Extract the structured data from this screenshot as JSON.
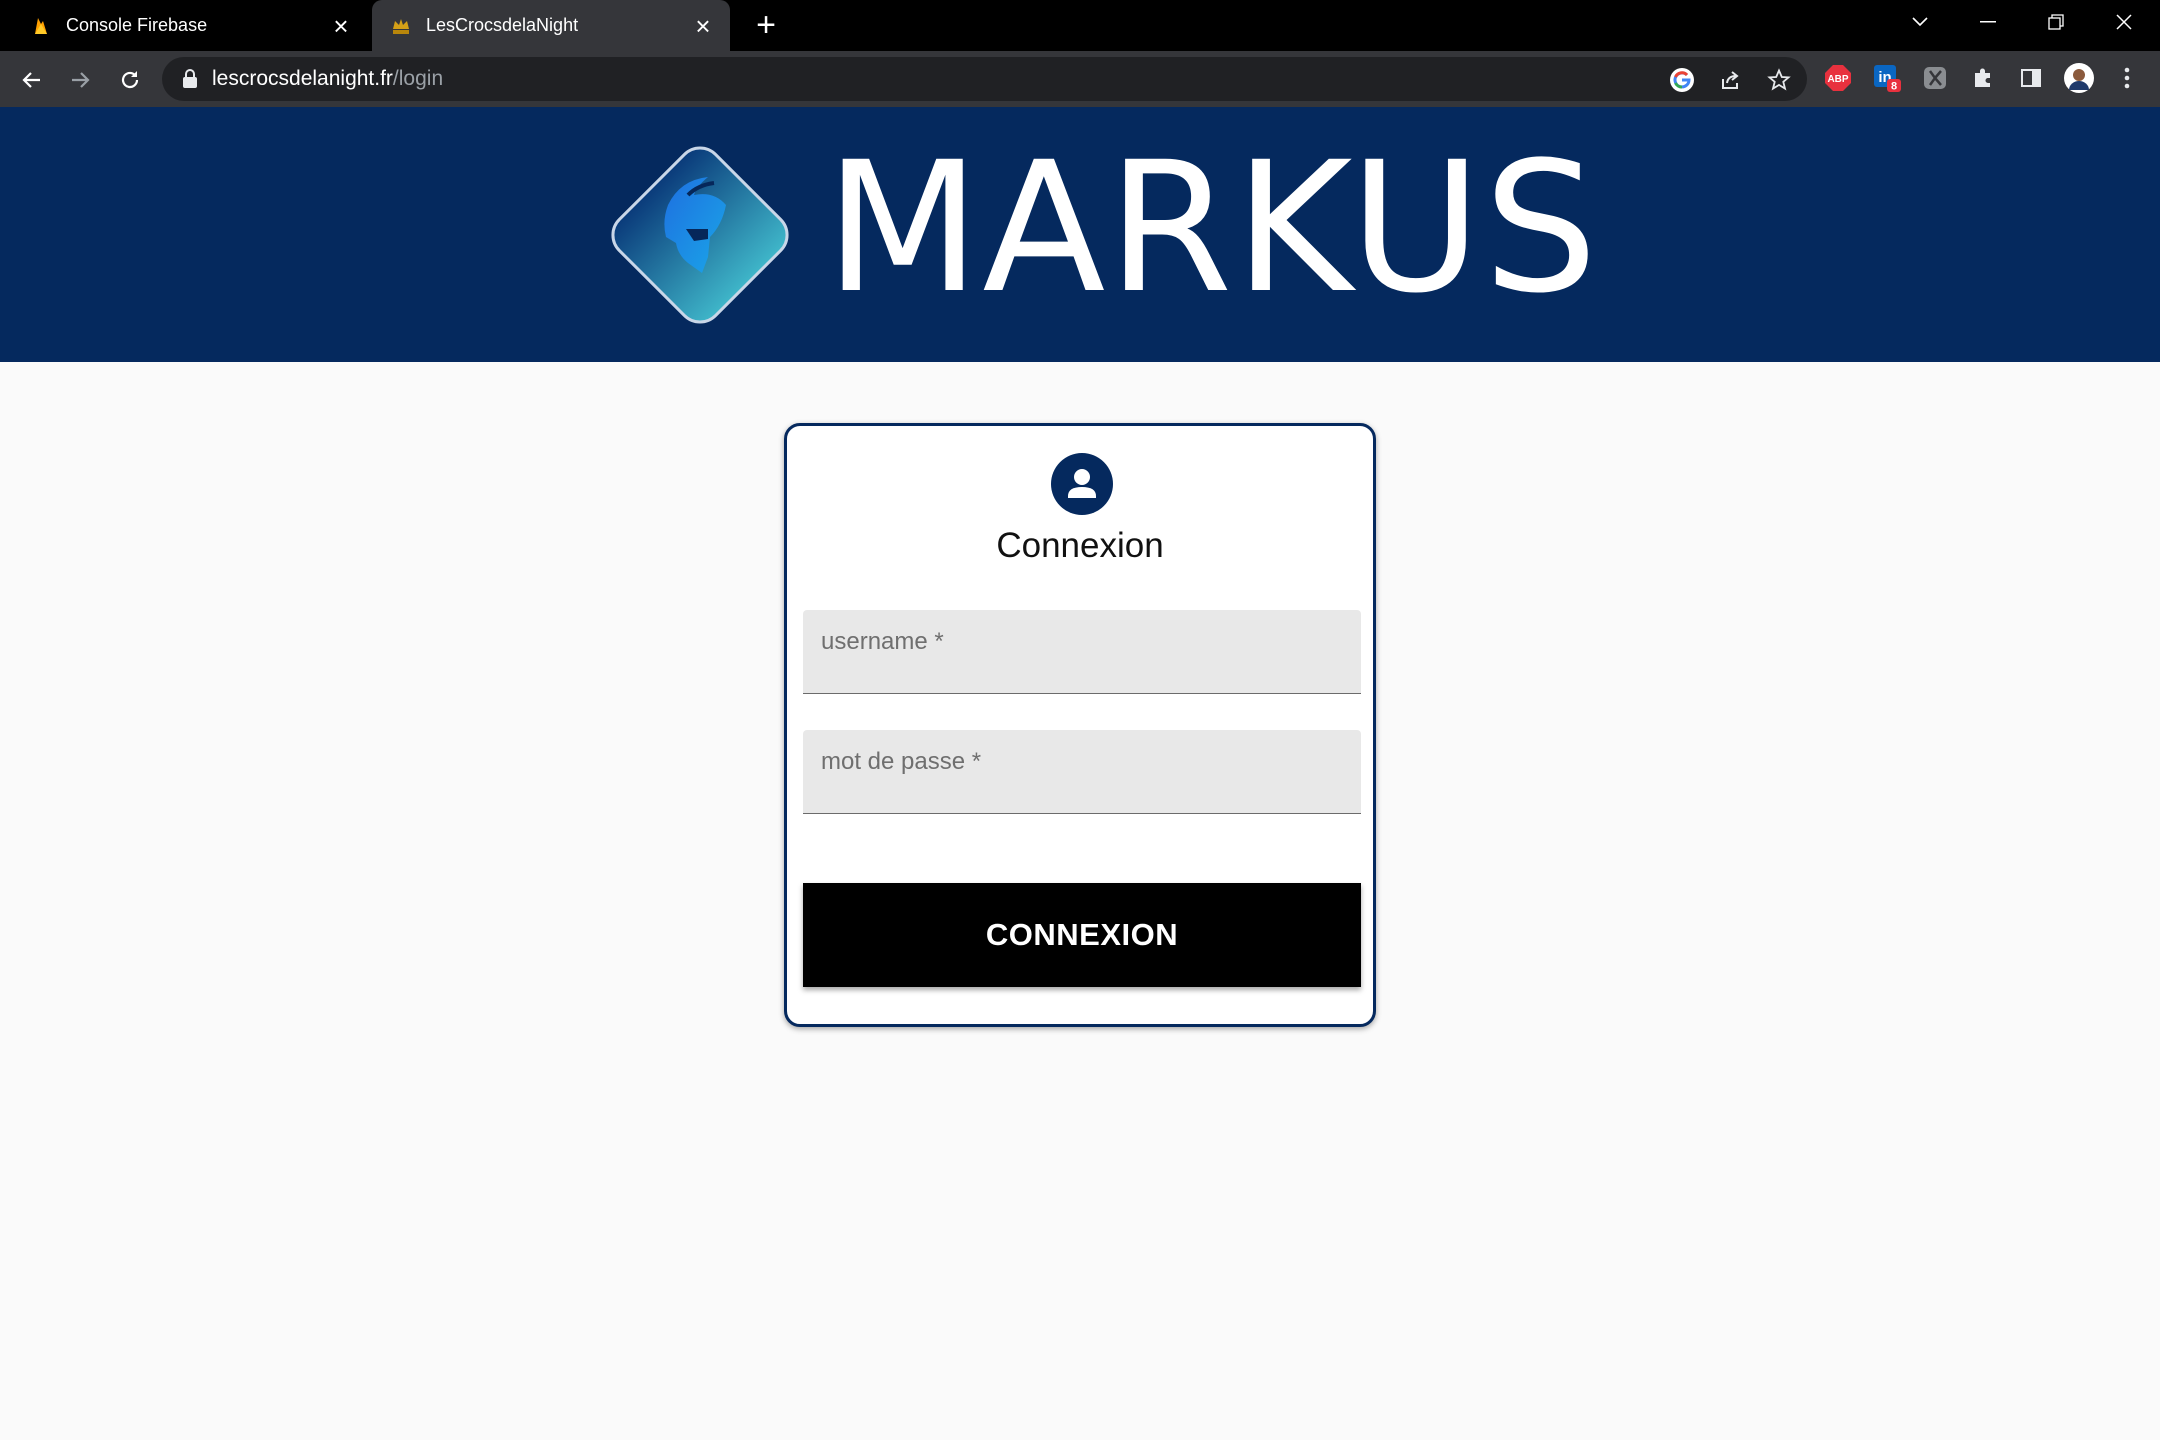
{
  "browser": {
    "tabs": [
      {
        "title": "Console Firebase",
        "favicon": "firebase-flame-icon",
        "active": false
      },
      {
        "title": "LesCrocsdelaNight",
        "favicon": "site-crown-icon",
        "active": true
      }
    ],
    "address_bar": {
      "host": "lescrocsdelanight.fr",
      "path": "/login"
    },
    "extensions": [
      "google-icon",
      "share-icon",
      "bookmark-star-icon",
      "adblock-plus-icon",
      "linkedin-icon",
      "extension-gray-icon",
      "puzzle-icon",
      "side-panel-icon",
      "profile-avatar-icon",
      "menu-kebab-icon"
    ],
    "adblock_label": "ABP",
    "linkedin_badge": "8",
    "colors": {
      "tabstrip": "#000000",
      "toolbar": "#35363a",
      "omnibox": "#202124"
    }
  },
  "header": {
    "brand": "MARKUS",
    "logo": "spartan-helmet-logo-icon",
    "background": "#05295e"
  },
  "login": {
    "title": "Connexion",
    "username_label": "username *",
    "password_label": "mot de passe *",
    "submit_label": "CONNEXION",
    "accent": "#05295e"
  }
}
